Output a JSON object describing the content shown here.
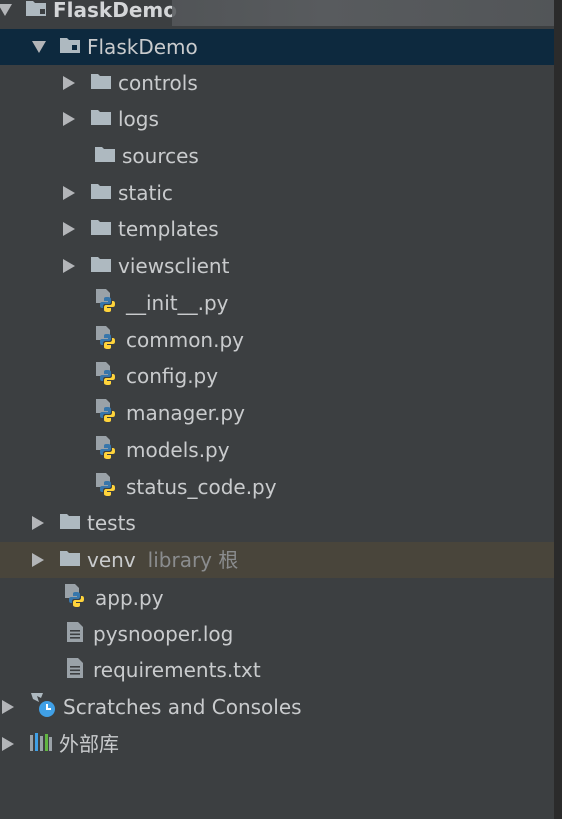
{
  "project_tree": {
    "root": {
      "label": "FlaskDemo"
    },
    "module": {
      "label": "FlaskDemo"
    },
    "folders": {
      "controls": "controls",
      "logs": "logs",
      "sources": "sources",
      "static": "static",
      "templates": "templates",
      "viewsclient": "viewsclient"
    },
    "py_files": {
      "init": "__init__.py",
      "common": "common.py",
      "config": "config.py",
      "manager": "manager.py",
      "models": "models.py",
      "status_code": "status_code.py"
    },
    "tests": "tests",
    "venv": {
      "label": "venv",
      "sub": "library 根"
    },
    "app_py": "app.py",
    "pysnooper_log": "pysnooper.log",
    "requirements_txt": "requirements.txt",
    "scratches": "Scratches and Consoles",
    "external_libs": "外部库"
  },
  "colors": {
    "background": "#3c3f41",
    "selection": "#0d293e",
    "excluded_row": "#49453b",
    "folder_icon": "#aeb9c0",
    "python_blue": "#3776ab",
    "python_yellow": "#ffd43b"
  }
}
